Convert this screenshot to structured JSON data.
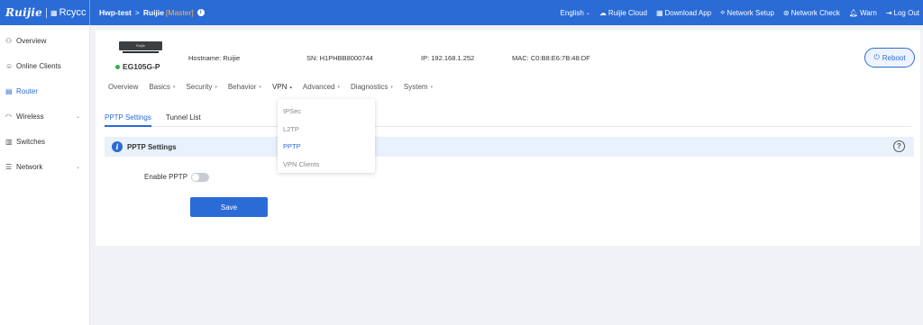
{
  "brand": {
    "logo": "Ruijie",
    "sub": "Rcycc"
  },
  "breadcrumb": {
    "project": "Hwp-test",
    "device": "Ruijie",
    "role": "[Master]"
  },
  "topnav": {
    "language": "English",
    "cloud": "Ruijie Cloud",
    "download": "Download App",
    "setup": "Network Setup",
    "check": "Network Check",
    "warn": "Warn",
    "logout": "Log Out"
  },
  "sidebar": {
    "items": [
      {
        "label": "Overview",
        "icon": "overview-icon"
      },
      {
        "label": "Online Clients",
        "icon": "clients-icon"
      },
      {
        "label": "Router",
        "icon": "router-icon"
      },
      {
        "label": "Wireless",
        "icon": "wireless-icon"
      },
      {
        "label": "Switches",
        "icon": "switch-icon"
      },
      {
        "label": "Network",
        "icon": "network-icon"
      }
    ]
  },
  "device": {
    "badge": "Ruijie",
    "model": "EG105G-P",
    "hostname_label": "Hostname:",
    "hostname": "Ruijie",
    "sn_label": "SN:",
    "sn": "H1PHBB8000744",
    "ip_label": "IP:",
    "ip": "192.168.1.252",
    "mac_label": "MAC:",
    "mac": "C0:B8:E6:7B:48:DF",
    "reboot": "Reboot"
  },
  "mainnav": {
    "items": [
      "Overview",
      "Basics",
      "Security",
      "Behavior",
      "VPN",
      "Advanced",
      "Diagnostics",
      "System"
    ]
  },
  "subtabs": [
    "PPTP Settings",
    "Tunnel List"
  ],
  "section": {
    "title": "PPTP Settings",
    "help": "?"
  },
  "form": {
    "enable_label": "Enable PPTP",
    "enable_value": false,
    "save": "Save"
  },
  "vpn_menu": [
    "IPSec",
    "L2TP",
    "PPTP",
    "VPN Clients"
  ],
  "colors": {
    "accent": "#2a6bd6",
    "online": "#2fb344",
    "master": "#ffb24d"
  }
}
